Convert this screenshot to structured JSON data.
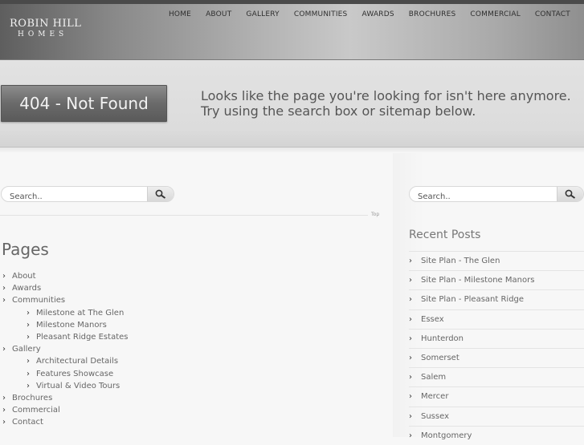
{
  "header": {
    "logo_top": "ROBIN HILL",
    "logo_bottom": "HOMES",
    "nav": [
      "HOME",
      "ABOUT",
      "GALLERY",
      "COMMUNITIES",
      "AWARDS",
      "BROCHURES",
      "COMMERCIAL",
      "CONTACT"
    ]
  },
  "banner": {
    "heading": "404 - Not Found",
    "message": "Looks like the page you're looking for isn't here anymore. Try using the search box or sitemap below."
  },
  "search": {
    "placeholder": "Search.."
  },
  "top_link": "Top",
  "pages": {
    "title": "Pages",
    "items": [
      {
        "label": "About",
        "level": 0
      },
      {
        "label": "Awards",
        "level": 0
      },
      {
        "label": "Communities",
        "level": 0
      },
      {
        "label": "Milestone at The Glen",
        "level": 1
      },
      {
        "label": "Milestone Manors",
        "level": 1
      },
      {
        "label": "Pleasant Ridge Estates",
        "level": 1
      },
      {
        "label": "Gallery",
        "level": 0
      },
      {
        "label": "Architectural Details",
        "level": 1
      },
      {
        "label": "Features Showcase",
        "level": 1
      },
      {
        "label": "Virtual & Video Tours",
        "level": 1
      },
      {
        "label": "Brochures",
        "level": 0
      },
      {
        "label": "Commercial",
        "level": 0
      },
      {
        "label": "Contact",
        "level": 0
      }
    ]
  },
  "recent_posts": {
    "title": "Recent Posts",
    "items": [
      "Site Plan - The Glen",
      "Site Plan - Milestone Manors",
      "Site Plan - Pleasant Ridge",
      "Essex",
      "Hunterdon",
      "Somerset",
      "Salem",
      "Mercer",
      "Sussex",
      "Montgomery"
    ]
  },
  "icons": {
    "search": "search-icon",
    "bullet": "chevron-right-icon"
  }
}
